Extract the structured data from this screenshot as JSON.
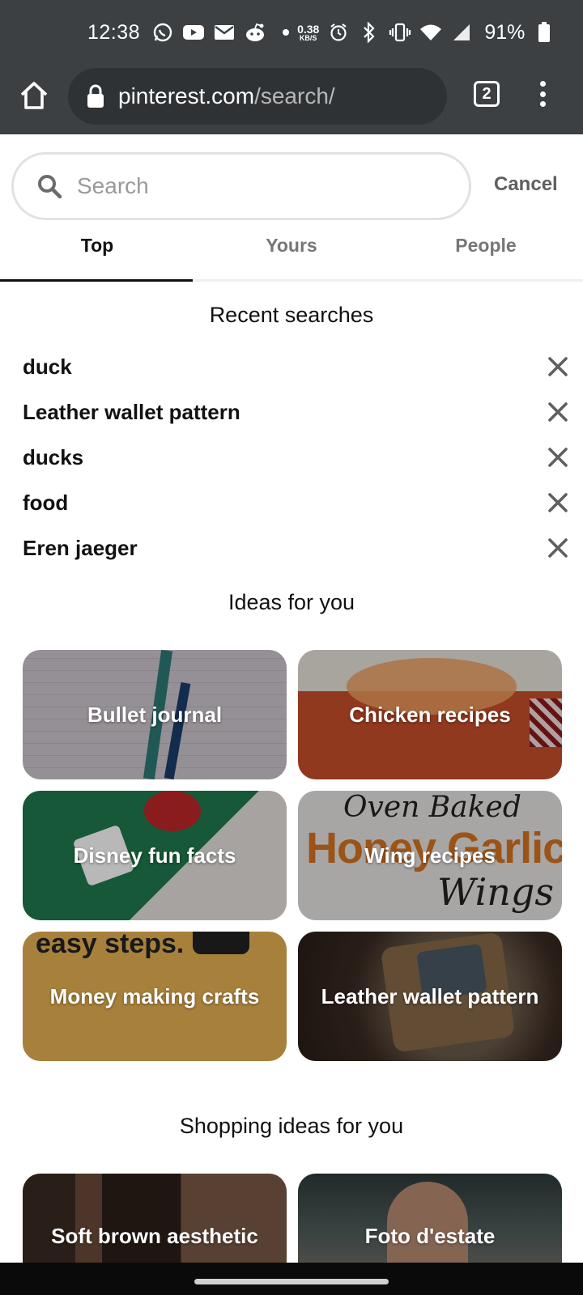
{
  "status_bar": {
    "time": "12:38",
    "net_speed_value": "0.38",
    "net_speed_unit": "KB/S",
    "battery": "91%"
  },
  "browser": {
    "url_host": "pinterest.com",
    "url_path": "/search/",
    "tab_count": "2"
  },
  "search": {
    "placeholder": "Search",
    "value": "",
    "cancel_label": "Cancel"
  },
  "tabs": [
    {
      "label": "Top",
      "active": true
    },
    {
      "label": "Yours",
      "active": false
    },
    {
      "label": "People",
      "active": false
    }
  ],
  "recent": {
    "title": "Recent searches",
    "items": [
      "duck",
      "Leather wallet pattern",
      "ducks",
      "food",
      "Eren jaeger"
    ]
  },
  "ideas": {
    "title": "Ideas for you",
    "cards": [
      "Bullet journal",
      "Chicken recipes",
      "Disney fun facts",
      "Wing recipes",
      "Money making crafts",
      "Leather wallet pattern"
    ],
    "image_text": {
      "wing_line1": "Oven Baked",
      "wing_line2": "Honey Garlic",
      "wing_line3": "Wings",
      "money_text": "easy steps."
    }
  },
  "shopping": {
    "title": "Shopping ideas for you",
    "cards": [
      "Soft brown aesthetic",
      "Foto d'estate"
    ]
  },
  "colors": {
    "chrome_bg": "#3c4043",
    "accent_text": "#111111",
    "muted_text": "#767676"
  }
}
